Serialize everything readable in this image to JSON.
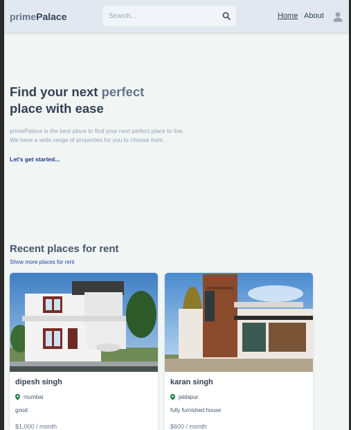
{
  "header": {
    "logo_prefix": "prime",
    "logo_suffix": "Palace",
    "search_placeholder": "Search...",
    "nav": {
      "home": "Home",
      "about": "About"
    }
  },
  "hero": {
    "title_start": "Find your next ",
    "title_accent": "perfect",
    "title_line2": "place with ease",
    "desc_line1": "primePalace is the best place to find your next perfect place to live.",
    "desc_line2": "We have a wide range of properties for you to choose from.",
    "cta": "Let's get started..."
  },
  "recent": {
    "title": "Recent places for rent",
    "show_more": "Show more places for rent",
    "listings": [
      {
        "name": "dipesh singh",
        "location": "mumbai",
        "description": "good",
        "price": "$1,000 / month",
        "image": "modern-white-house-photo"
      },
      {
        "name": "karan singh",
        "location": "jablapur",
        "description": "fully furnished house",
        "price": "$600 / month",
        "image": "modern-wood-house-photo"
      }
    ]
  },
  "icons": {
    "search": "search-icon",
    "user": "user-icon",
    "location": "map-pin-icon"
  },
  "colors": {
    "header_bg": "#e2e8f0",
    "page_bg": "#f1f5f4",
    "text_dark": "#334155",
    "text_slate": "#64748b",
    "link_blue": "#1e3a8a",
    "pin_green": "#15803d"
  }
}
